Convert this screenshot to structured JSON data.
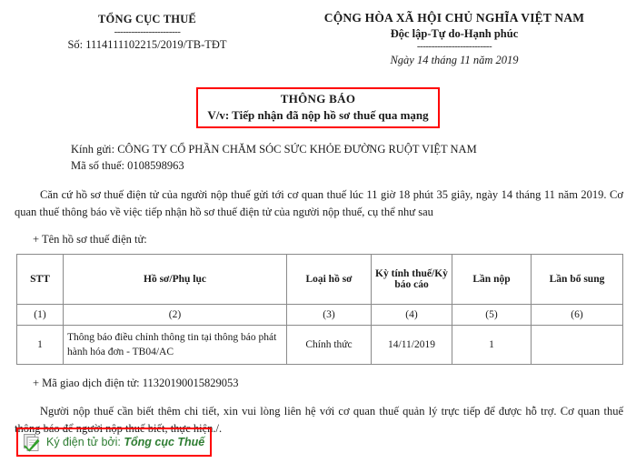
{
  "header": {
    "org_name": "TỔNG CỤC THUẾ",
    "left_rule": "-----------------------",
    "doc_number": "Số: 1114111102215/2019/TB-TĐT",
    "country": "CỘNG HÒA XÃ HỘI CHỦ NGHĨA VIỆT NAM",
    "motto": "Độc lập-Tự do-Hạnh phúc",
    "right_rule": "--------------------------",
    "date_line": "Ngày 14 tháng 11 năm 2019"
  },
  "title": {
    "main": "THÔNG BÁO",
    "sub": "V/v: Tiếp nhận đã nộp hồ sơ thuế qua mạng",
    "border_color": "#ff0000"
  },
  "recipient": {
    "to_line": "Kính gửi: CÔNG TY CỔ PHẦN CHĂM SÓC SỨC KHỎE ĐƯỜNG RUỘT VIỆT NAM",
    "tax_code_line": "Mã số thuế: 0108598963"
  },
  "body": {
    "intro": "Căn cứ hồ sơ thuế điện tử của người nộp thuế gửi tới cơ quan thuế lúc 11 giờ 18 phút 35 giây, ngày 14 tháng 11 năm 2019. Cơ quan thuế thông báo về việc tiếp nhận hồ sơ thuế điện tử của người nộp thuế, cụ thể như sau",
    "list_label": "+ Tên hồ sơ thuế điện tử:",
    "transaction_line": "+ Mã giao dịch điện tử: 11320190015829053",
    "closing": "Người nộp thuế cần biết thêm chi tiết, xin vui lòng liên hệ với cơ quan thuế quản lý trực tiếp để được hỗ trợ. Cơ quan thuế thông báo để người nộp thuế biết, thực hiện./."
  },
  "table": {
    "headers": [
      "STT",
      "Hồ sơ/Phụ lục",
      "Loại hồ sơ",
      "Kỳ tính thuế/Kỳ báo cáo",
      "Lần nộp",
      "Lần bổ sung"
    ],
    "number_row": [
      "(1)",
      "(2)",
      "(3)",
      "(4)",
      "(5)",
      "(6)"
    ],
    "rows": [
      {
        "stt": "1",
        "description": "Thông báo điều chỉnh thông tin tại thông báo phát hành hóa đơn - TB04/AC",
        "loai_ho_so": "Chính thức",
        "ky_tinh_thue": "14/11/2019",
        "lan_nop": "1",
        "lan_bo_sung": ""
      }
    ]
  },
  "signature": {
    "icon": "signed-document-check-icon",
    "label": "Ký điện tử bởi:",
    "signer": "Tổng cục Thuế",
    "text_color": "#2e7d32",
    "border_color": "#ff0000"
  }
}
